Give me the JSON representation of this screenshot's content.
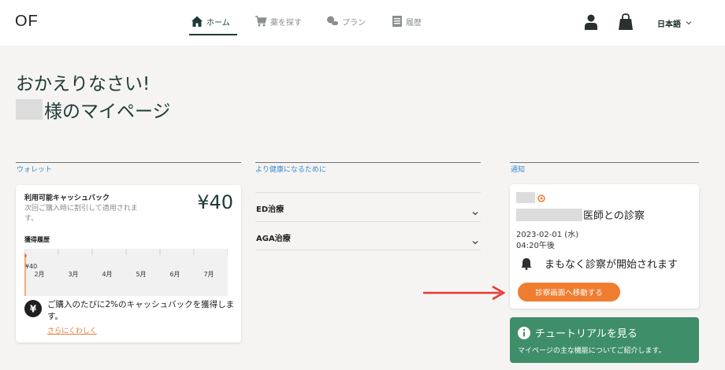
{
  "header": {
    "logo": "OF",
    "nav": [
      {
        "label": "ホーム",
        "icon": "home-icon",
        "active": true
      },
      {
        "label": "薬を探す",
        "icon": "cart-icon",
        "active": false
      },
      {
        "label": "プラン",
        "icon": "pill-icon",
        "active": false
      },
      {
        "label": "履歴",
        "icon": "history-icon",
        "active": false
      }
    ],
    "language": "日本語"
  },
  "greeting": "おかえりなさい!",
  "mypage_title": "様のマイページ",
  "wallet": {
    "section_title": "ウォレット",
    "label": "利用可能キャッシュバック",
    "description": "次回ご購入時に割引して適用されます。",
    "amount": "¥40",
    "history_label": "獲得履歴",
    "chart_value_label": "¥40",
    "months": [
      "2月",
      "3月",
      "4月",
      "5月",
      "6月",
      "7月"
    ],
    "info": "ご購入のたびに2%のキャッシュバックを獲得します。",
    "link": "さらにくわしく"
  },
  "health": {
    "section_title": "より健康になるために",
    "items": [
      {
        "label": "ED治療"
      },
      {
        "label": "AGA治療"
      }
    ]
  },
  "notice": {
    "section_title": "通知",
    "doctor_suffix": "医師との診察",
    "date": "2023-02-01 (水)",
    "time": "04:20午後",
    "message": "まもなく診察が開始されます",
    "button": "診察画面へ移動する"
  },
  "tutorial": {
    "title": "チュートリアルを見る",
    "subtitle": "マイページの主な機能についてご紹介します。"
  },
  "colors": {
    "primary": "#1f3b37",
    "accent_orange": "#f07c2f",
    "tutorial_green": "#3e8e6a",
    "link_blue": "#3a8ad1",
    "arrow_red": "#e53935"
  }
}
